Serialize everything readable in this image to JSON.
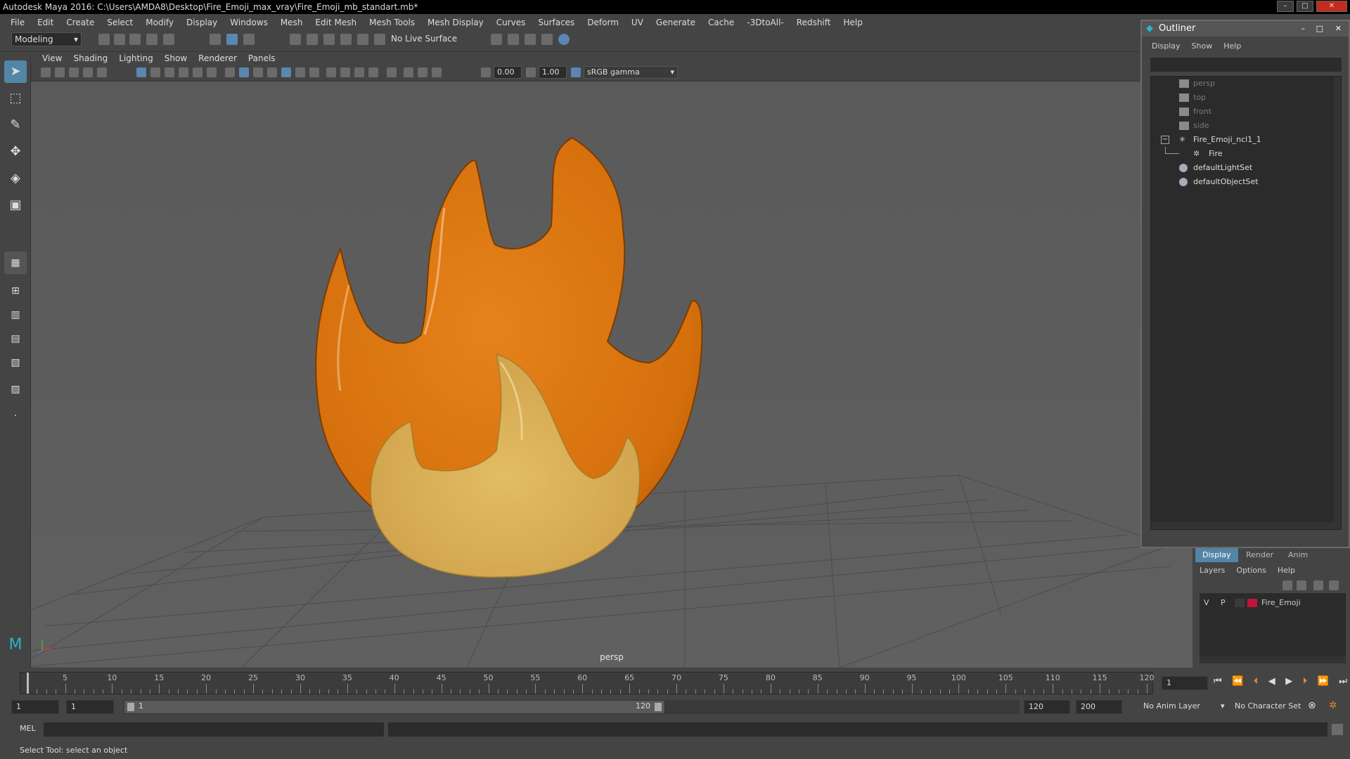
{
  "window": {
    "title": "Autodesk Maya 2016: C:\\Users\\AMDA8\\Desktop\\Fire_Emoji_max_vray\\Fire_Emoji_mb_standart.mb*"
  },
  "menubar": [
    "File",
    "Edit",
    "Create",
    "Select",
    "Modify",
    "Display",
    "Windows",
    "Mesh",
    "Edit Mesh",
    "Mesh Tools",
    "Mesh Display",
    "Curves",
    "Surfaces",
    "Deform",
    "UV",
    "Generate",
    "Cache",
    "-3DtoAll-",
    "Redshift",
    "Help"
  ],
  "toolbar": {
    "mode": "Modeling",
    "live_surface": "No Live Surface"
  },
  "viewport": {
    "menu": [
      "View",
      "Shading",
      "Lighting",
      "Show",
      "Renderer",
      "Panels"
    ],
    "exposure": "0.00",
    "gamma": "1.00",
    "colorspace": "sRGB gamma",
    "camera_label": "persp"
  },
  "timeline": {
    "ticks": [
      5,
      10,
      15,
      20,
      25,
      30,
      35,
      40,
      45,
      50,
      55,
      60,
      65,
      70,
      75,
      80,
      85,
      90,
      95,
      100,
      105,
      110,
      115,
      120
    ],
    "min": 1,
    "max": 120,
    "current_frame": "1"
  },
  "range": {
    "start": "1",
    "anim_start": "1",
    "slider_start": "1",
    "slider_end": "120",
    "end": "120",
    "anim_end": "200",
    "anim_layer": "No Anim Layer",
    "character_set": "No Character Set"
  },
  "mel": {
    "label": "MEL"
  },
  "status": {
    "text": "Select Tool: select an object"
  },
  "outliner": {
    "title": "Outliner",
    "menu": [
      "Display",
      "Show",
      "Help"
    ],
    "items": [
      {
        "label": "persp",
        "dim": true
      },
      {
        "label": "top",
        "dim": true
      },
      {
        "label": "front",
        "dim": true
      },
      {
        "label": "side",
        "dim": true
      },
      {
        "label": "Fire_Emoji_ncl1_1",
        "dim": false
      },
      {
        "label": "Fire",
        "dim": false
      },
      {
        "label": "defaultLightSet",
        "dim": false
      },
      {
        "label": "defaultObjectSet",
        "dim": false
      }
    ]
  },
  "layers": {
    "tabs": [
      "Display",
      "Render",
      "Anim"
    ],
    "menu": [
      "Layers",
      "Options",
      "Help"
    ],
    "row": {
      "v": "V",
      "p": "P",
      "name": "Fire_Emoji",
      "color": "#c0143c"
    }
  },
  "colors": {
    "flame_outer": "#e07b12",
    "flame_inner": "#e0b45a",
    "accent": "#5285a6"
  }
}
